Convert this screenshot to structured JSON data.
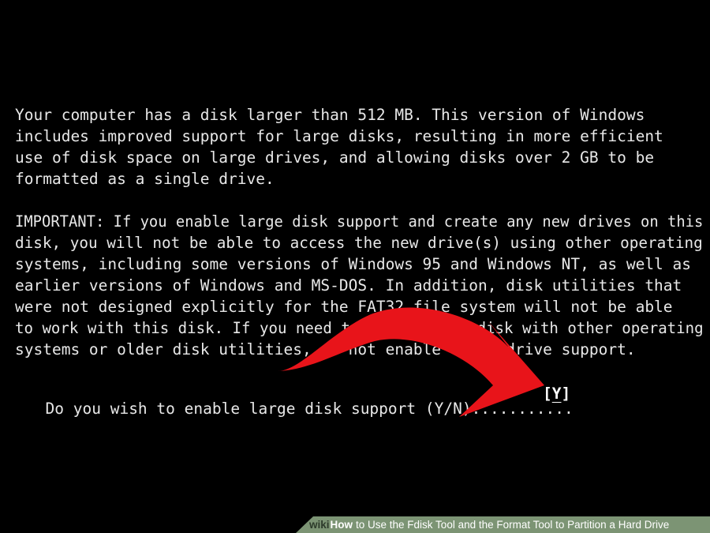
{
  "screen": {
    "paragraph1": [
      "Your computer has a disk larger than 512 MB. This version of Windows",
      "includes improved support for large disks, resulting in more efficient",
      "use of disk space on large drives, and allowing disks over 2 GB to be",
      "formatted as a single drive."
    ],
    "paragraph2": [
      "IMPORTANT: If you enable large disk support and create any new drives on this",
      "disk, you will not be able to access the new drive(s) using other operating",
      "systems, including some versions of Windows 95 and Windows NT, as well as",
      "earlier versions of Windows and MS-DOS. In addition, disk utilities that",
      "were not designed explicitly for the FAT32 file system will not be able",
      "to work with this disk. If you need to access this disk with other operating",
      "systems or older disk utilities, do not enable large drive support."
    ],
    "prompt": "Do you wish to enable large disk support (Y/N)...........",
    "answer_open": "[",
    "answer_value": "Y",
    "answer_close": "]"
  },
  "footer": {
    "brand": "wiki",
    "how": "How",
    "title": "to Use the Fdisk Tool and the Format Tool to Partition a Hard Drive"
  },
  "colors": {
    "background": "#000000",
    "text": "#e8e8e8",
    "arrow": "#e8141a",
    "footer": "#7c9474"
  }
}
